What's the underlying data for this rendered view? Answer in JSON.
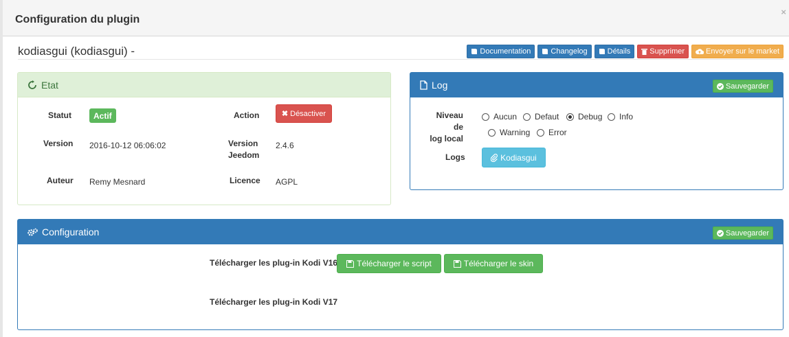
{
  "dialog": {
    "title": "Configuration du plugin",
    "close": "×"
  },
  "plugin": {
    "title": "kodiasgui (kodiasgui) -"
  },
  "actions": {
    "documentation": "Documentation",
    "changelog": "Changelog",
    "details": "Détails",
    "delete": "Supprimer",
    "market": "Envoyer sur le market"
  },
  "state": {
    "heading": "Etat",
    "status_label": "Statut",
    "status_value": "Actif",
    "action_label": "Action",
    "action_button": "Désactiver",
    "version_label": "Version",
    "version_value": "2016-10-12 06:06:02",
    "jeedom_version_label_1": "Version",
    "jeedom_version_label_2": "Jeedom",
    "jeedom_version_value": "2.4.6",
    "author_label": "Auteur",
    "author_value": "Remy Mesnard",
    "license_label": "Licence",
    "license_value": "AGPL"
  },
  "log": {
    "heading": "Log",
    "save": "Sauvegarder",
    "level_label_1": "Niveau de",
    "level_label_2": "log local",
    "levels": [
      {
        "label": "Aucun",
        "checked": false
      },
      {
        "label": "Defaut",
        "checked": false
      },
      {
        "label": "Debug",
        "checked": true
      },
      {
        "label": "Info",
        "checked": false
      },
      {
        "label": "Warning",
        "checked": false
      },
      {
        "label": "Error",
        "checked": false
      }
    ],
    "logs_label": "Logs",
    "logs_button": "Kodiasgui"
  },
  "config": {
    "heading": "Configuration",
    "save": "Sauvegarder",
    "v16_label": "Télécharger les plug-in Kodi V16",
    "script_button": "Télécharger le script",
    "skin_button": "Télécharger le skin",
    "v17_label": "Télécharger les plug-in Kodi V17"
  },
  "colors": {
    "primary": "#337ab7",
    "success": "#5cb85c",
    "danger": "#d9534f",
    "warning": "#f0ad4e",
    "info": "#5bc0de",
    "success_panel_bg": "#dff0d8"
  }
}
